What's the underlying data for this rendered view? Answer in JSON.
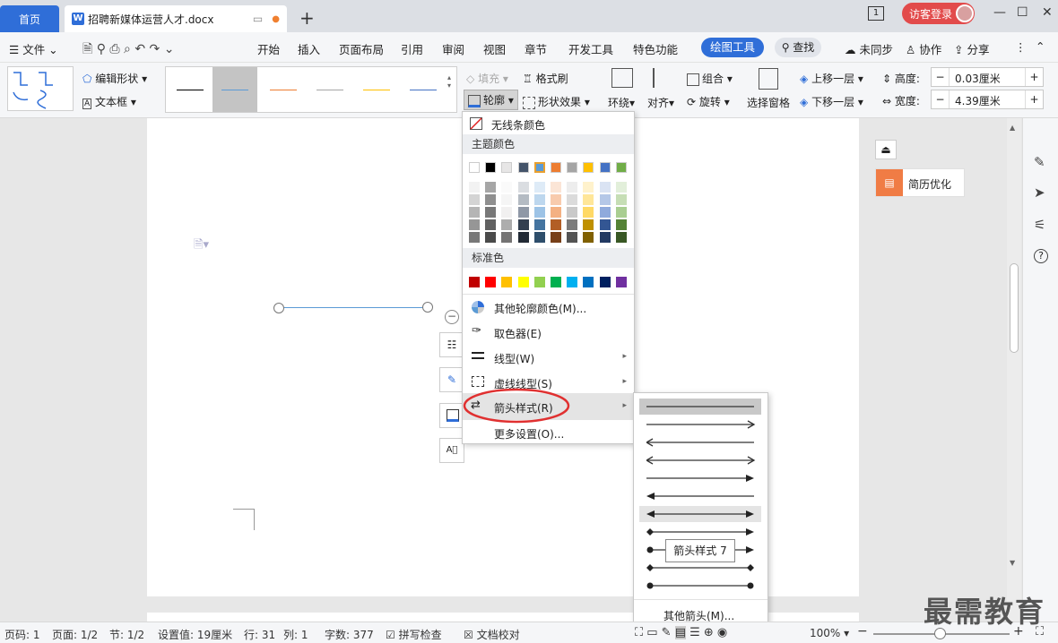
{
  "tabs": {
    "home": "首页",
    "doc": "招聘新媒体运营人才.docx",
    "doc_badge": "W",
    "add": "+"
  },
  "account": {
    "guest_login": "访客登录"
  },
  "window": {
    "minimize": "—",
    "maximize": "☐",
    "close": "✕",
    "screen": "1"
  },
  "menu": {
    "file": "文件",
    "items": [
      "开始",
      "插入",
      "页面布局",
      "引用",
      "审阅",
      "视图",
      "章节",
      "开发工具",
      "特色功能"
    ],
    "draw_tools": "绘图工具",
    "search": "查找",
    "unsynced": "未同步",
    "collab": "协作",
    "share": "分享"
  },
  "ribbon": {
    "edit_shape": "编辑形状",
    "textbox": "文本框",
    "fill": "填充",
    "outline": "轮廓",
    "format_painter": "格式刷",
    "shape_effect": "形状效果",
    "wrap": "环绕",
    "align": "对齐",
    "group": "组合",
    "rotate": "旋转",
    "selection_pane": "选择窗格",
    "bring_forward": "上移一层",
    "send_backward": "下移一层",
    "height_label": "高度:",
    "height_value": "0.03厘米",
    "width_label": "宽度:",
    "width_value": "4.39厘米"
  },
  "line_styles": {
    "colors": [
      "#000000",
      "#5b9bd5",
      "#ed7d31",
      "#a5a5a5",
      "#ffc000",
      "#4472c4"
    ]
  },
  "right_panel": {
    "resume_opt": "简历优化"
  },
  "outline_menu": {
    "no_line": "无线条颜色",
    "theme_colors_label": "主题颜色",
    "theme_colors": [
      "#ffffff",
      "#000000",
      "#e7e6e6",
      "#44546a",
      "#5b9bd5",
      "#ed7d31",
      "#a5a5a5",
      "#ffc000",
      "#4472c4",
      "#70ad47"
    ],
    "standard_colors_label": "标准色",
    "standard_colors": [
      "#c00000",
      "#ff0000",
      "#ffc000",
      "#ffff00",
      "#92d050",
      "#00b050",
      "#00b0f0",
      "#0070c0",
      "#002060",
      "#7030a0"
    ],
    "more_colors": "其他轮廓颜色(M)...",
    "eyedropper": "取色器(E)",
    "line_type": "线型(W)",
    "dash_type": "虚线线型(S)",
    "arrow_style": "箭头样式(R)",
    "more_settings": "更多设置(O)..."
  },
  "arrow_menu": {
    "tooltip": "箭头样式 7",
    "more_arrows": "其他箭头(M)..."
  },
  "status": {
    "page_code": "页码: 1",
    "page": "页面: 1/2",
    "section": "节: 1/2",
    "setting": "设置值: 19厘米",
    "row": "行: 31",
    "col": "列: 1",
    "words": "字数: 377",
    "spell": "拼写检查",
    "proof": "文档校对",
    "zoom": "100%"
  },
  "watermark": "最需教育"
}
